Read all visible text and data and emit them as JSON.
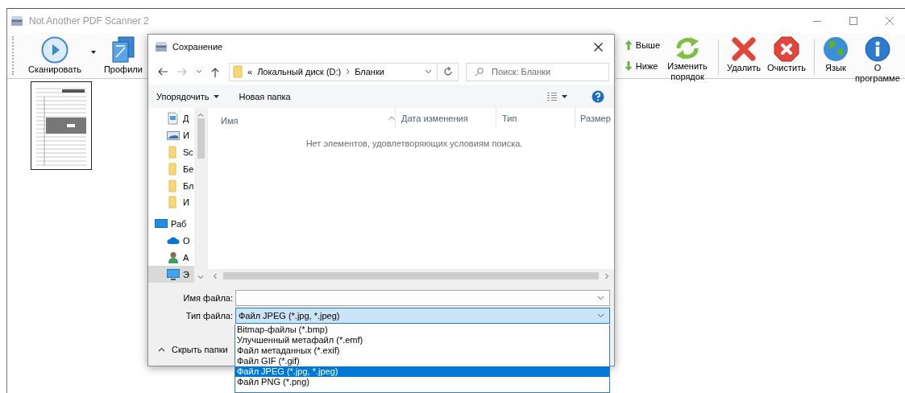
{
  "window": {
    "title": "Not Another PDF Scanner 2"
  },
  "toolbar": [
    {
      "kind": "scan",
      "label": "Сканировать"
    },
    {
      "kind": "profiles",
      "label": "Профили"
    },
    {
      "kind": "up",
      "label": "Выше"
    },
    {
      "kind": "down",
      "label": "Ниже"
    },
    {
      "kind": "reorder",
      "label": "Изменить порядок"
    },
    {
      "kind": "delete",
      "label": "Удалить"
    },
    {
      "kind": "clear",
      "label": "Очистить"
    },
    {
      "kind": "language",
      "label": "Язык"
    },
    {
      "kind": "about",
      "label": "О программе"
    }
  ],
  "dialog": {
    "title": "Сохранение",
    "address": {
      "overflow": "«",
      "crumbs": [
        "Локальный диск (D:)",
        "Бланки"
      ]
    },
    "search": {
      "placeholder": "Поиск: Бланки"
    },
    "commands": [
      {
        "kind": "menu",
        "label": "Упорядочить"
      },
      {
        "kind": "plain",
        "label": "Новая папка"
      }
    ],
    "nav_items": [
      {
        "kind": "document",
        "label": "Д",
        "selected": false
      },
      {
        "kind": "pictures",
        "label": "И",
        "selected": false
      },
      {
        "kind": "folder",
        "label": "Sc",
        "selected": false
      },
      {
        "kind": "folder",
        "label": "Бе",
        "selected": false
      },
      {
        "kind": "folder",
        "label": "Бл",
        "selected": false
      },
      {
        "kind": "folder",
        "label": "И",
        "selected": false
      },
      {
        "kind": "desktop",
        "label": "Раб",
        "selected": false
      },
      {
        "kind": "cloud",
        "label": "O",
        "selected": false
      },
      {
        "kind": "user",
        "label": "A",
        "selected": false
      },
      {
        "kind": "computer",
        "label": "Э",
        "selected": true
      }
    ],
    "columns": [
      "Имя",
      "Дата изменения",
      "Тип",
      "Размер"
    ],
    "empty_message": "Нет элементов, удовлетворяющих условиям поиска.",
    "file_name": {
      "label": "Имя файла:"
    },
    "file_type": {
      "label": "Тип файла:",
      "value": "Файл JPEG (*.jpg, *.jpeg)"
    },
    "hide_folders": "Скрыть папки"
  },
  "file_type_options": [
    {
      "label": "Bitmap-файлы (*.bmp)",
      "selected": false
    },
    {
      "label": "Улучшенный метафайл (*.emf)",
      "selected": false
    },
    {
      "label": "Файл метаданных (*.exif)",
      "selected": false
    },
    {
      "label": "Файл GIF (*.gif)",
      "selected": false
    },
    {
      "label": "Файл JPEG (*.jpg, *.jpeg)",
      "selected": true
    },
    {
      "label": "Файл PNG (*.png)",
      "selected": false
    }
  ]
}
